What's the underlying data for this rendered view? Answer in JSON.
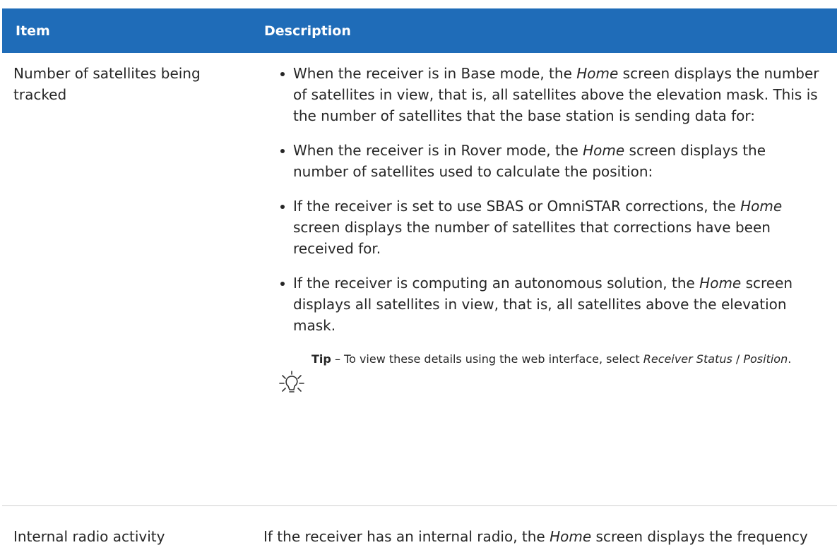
{
  "table": {
    "header": {
      "item": "Item",
      "description": "Description"
    },
    "rows": [
      {
        "item": "Number of satellites being tracked",
        "bullets": [
          {
            "before": "When the receiver is in Base mode, the ",
            "em": "Home",
            "after": " screen displays the number of satellites in view, that is, all satellites above the elevation mask. This is the number of satellites that the base station is sending data for:"
          },
          {
            "before": "When the receiver is in Rover mode, the ",
            "em": "Home",
            "after": " screen displays the number of satellites used to calculate the position:"
          },
          {
            "before": "If the receiver is set to use SBAS or OmniSTAR corrections, the ",
            "em": "Home",
            "after": " screen displays the number of satellites that corrections have been received for."
          },
          {
            "before": "If the receiver is computing an autonomous solution, the ",
            "em": "Home",
            "after": " screen displays all satellites in view, that is, all satellites above the elevation mask."
          }
        ],
        "tip": {
          "label": "Tip",
          "dash": " – ",
          "text": "To view these details using the web interface, select ",
          "em1": "Receiver Status",
          "sep": " / ",
          "em2": "Position",
          "end": "."
        }
      },
      {
        "item": "Internal radio activity",
        "before": "If the receiver has an internal radio, the ",
        "em": "Home",
        "after": " screen displays the frequency or channel being used and the transmit/receive status."
      }
    ]
  },
  "colors": {
    "header_bg": "#1f6cb8",
    "header_text": "#ffffff",
    "body_text": "#262626"
  }
}
